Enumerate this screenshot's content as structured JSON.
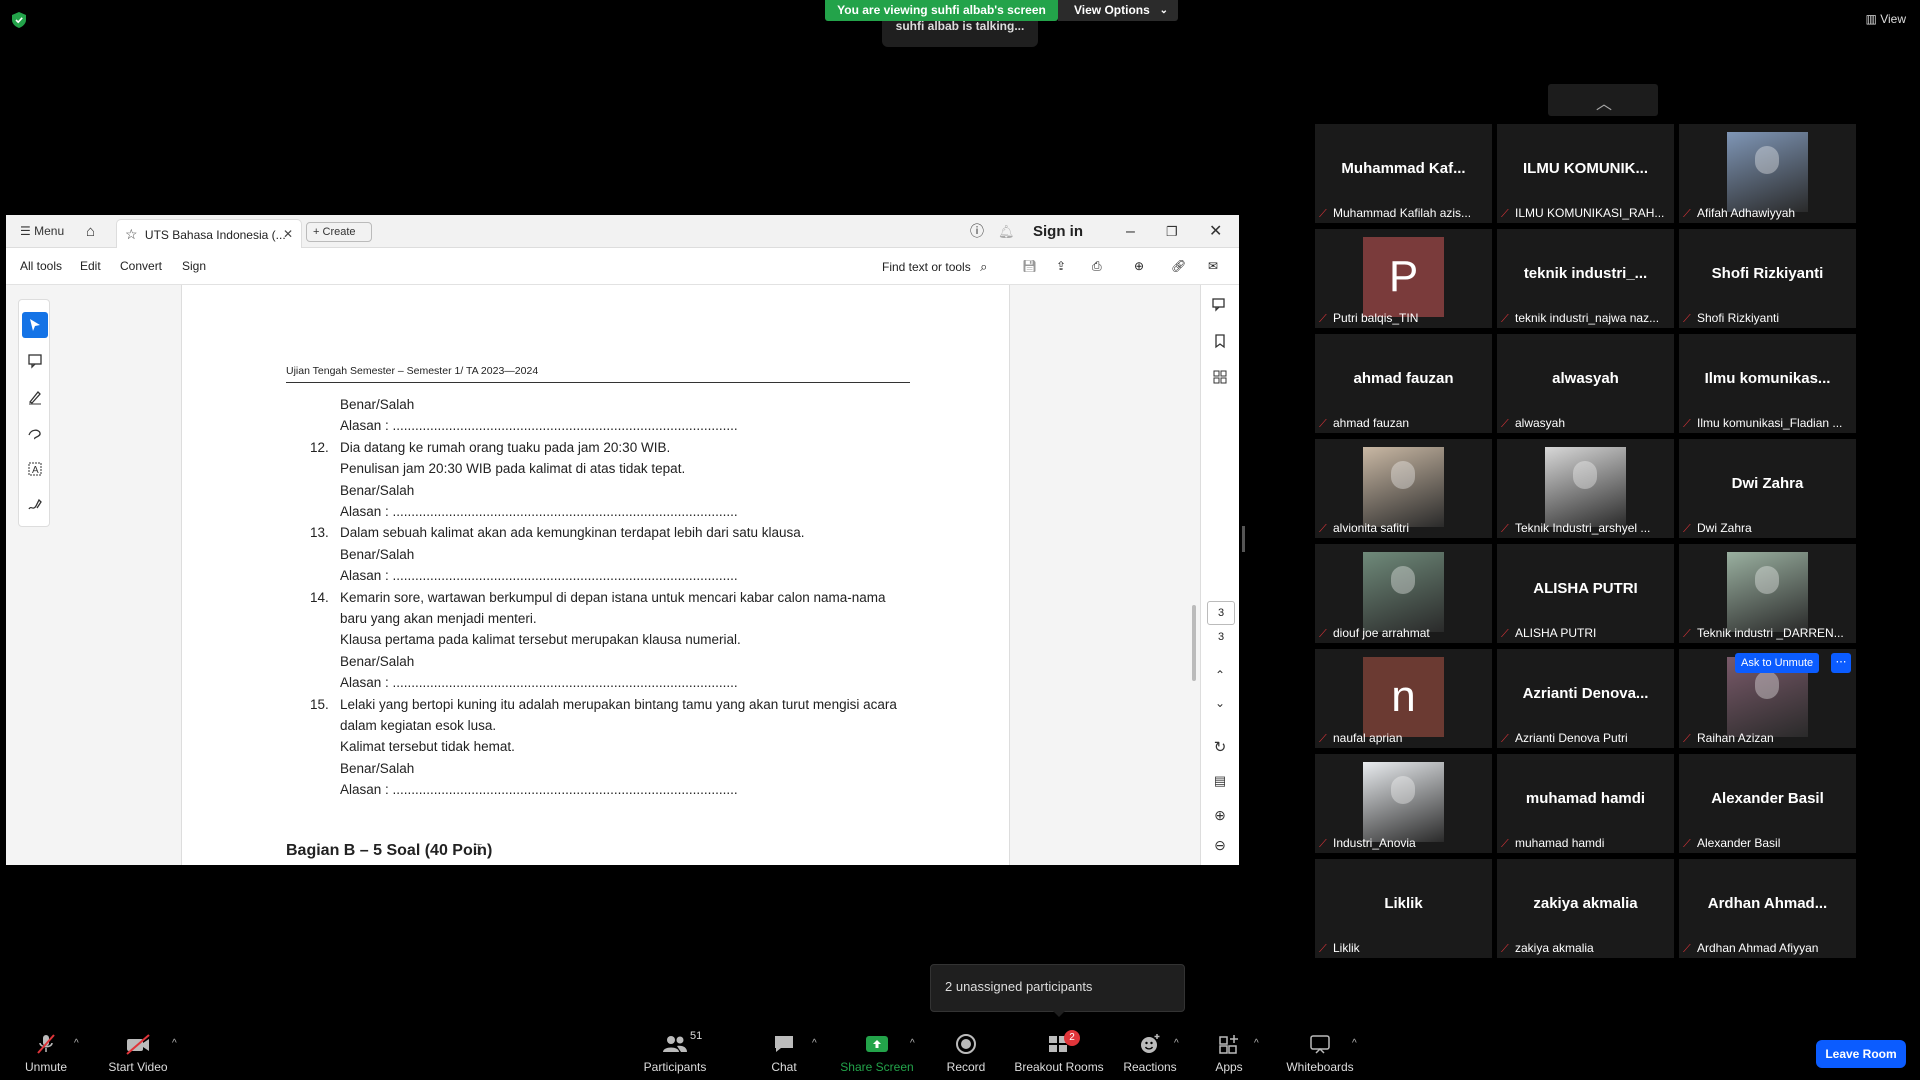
{
  "banner": {
    "viewing": "You are viewing suhfi albab's screen",
    "view_options": "View Options",
    "talking": "suhfi albab is talking..."
  },
  "view_label": "View",
  "window": {
    "menu": "Menu",
    "tab_title": "UTS Bahasa Indonesia (...",
    "create": "Create",
    "sign_in": "Sign in",
    "tools": [
      "All tools",
      "Edit",
      "Convert",
      "Sign"
    ],
    "find": "Find text or tools",
    "page_box": "3",
    "page_total": "3"
  },
  "document": {
    "header": "Ujian Tengah Semester  – Semester 1/ TA 2023—2024",
    "lines": [
      {
        "num": "",
        "text": "Benar/Salah"
      },
      {
        "num": "",
        "text": "Alasan : ............................................................................................"
      },
      {
        "num": "12.",
        "text": "Dia datang ke rumah orang tuaku pada jam 20:30 WIB."
      },
      {
        "num": "",
        "text": "Penulisan jam 20:30 WIB pada kalimat di atas tidak tepat."
      },
      {
        "num": "",
        "text": "Benar/Salah"
      },
      {
        "num": "",
        "text": "Alasan : ............................................................................................"
      },
      {
        "num": "13.",
        "text": "Dalam sebuah kalimat akan ada kemungkinan terdapat lebih dari satu klausa."
      },
      {
        "num": "",
        "text": "Benar/Salah"
      },
      {
        "num": "",
        "text": "Alasan : ............................................................................................"
      },
      {
        "num": "14.",
        "text": "Kemarin sore, wartawan berkumpul di depan istana untuk mencari kabar calon nama-nama"
      },
      {
        "num": "",
        "text": "baru yang akan menjadi menteri."
      },
      {
        "num": "",
        "text": "Klausa pertama pada kalimat tersebut merupakan klausa numerial."
      },
      {
        "num": "",
        "text": "Benar/Salah"
      },
      {
        "num": "",
        "text": "Alasan : ............................................................................................"
      },
      {
        "num": "15.",
        "text": "Lelaki yang bertopi kuning itu adalah merupakan bintang tamu yang akan turut mengisi acara"
      },
      {
        "num": "",
        "text": "dalam kegiatan esok lusa."
      },
      {
        "num": "",
        "text": "Kalimat tersebut tidak hemat."
      },
      {
        "num": "",
        "text": "Benar/Salah"
      },
      {
        "num": "",
        "text": "Alasan : ............................................................................................"
      }
    ],
    "section": "Bagian B – 5 Soal (40 Poin)"
  },
  "participants": [
    {
      "display": "Muhammad  Kaf...",
      "label": "Muhammad Kafilah azis...",
      "type": "name"
    },
    {
      "display": "ILMU  KOMUNIK...",
      "label": "ILMU KOMUNIKASI_RAH...",
      "type": "name"
    },
    {
      "display": "",
      "label": "Afifah Adhawiyyah",
      "type": "photo",
      "color": "#7f96b6"
    },
    {
      "display": "P",
      "label": "Putri balqis_TIN",
      "type": "letter",
      "color": "#7a3b3b"
    },
    {
      "display": "teknik  industri_...",
      "label": "teknik industri_najwa naz...",
      "type": "name"
    },
    {
      "display": "Shofi Rizkiyanti",
      "label": "Shofi Rizkiyanti",
      "type": "name"
    },
    {
      "display": "ahmad fauzan",
      "label": "ahmad fauzan",
      "type": "name"
    },
    {
      "display": "alwasyah",
      "label": "alwasyah",
      "type": "name"
    },
    {
      "display": "Ilmu  komunikas...",
      "label": "Ilmu komunikasi_Fladian ...",
      "type": "name"
    },
    {
      "display": "",
      "label": "alvionita safitri",
      "type": "photo",
      "color": "#c9b8a4"
    },
    {
      "display": "",
      "label": "Teknik Industri_arshyel ...",
      "type": "photo",
      "color": "#d8d8d8"
    },
    {
      "display": "Dwi Zahra",
      "label": "Dwi Zahra",
      "type": "name"
    },
    {
      "display": "",
      "label": "diouf joe arrahmat",
      "type": "photo",
      "color": "#6f8a7a"
    },
    {
      "display": "ALISHA PUTRI",
      "label": "ALISHA PUTRI",
      "type": "name"
    },
    {
      "display": "",
      "label": "Teknik industri _DARREN...",
      "type": "photo",
      "color": "#9ab0a0"
    },
    {
      "display": "n",
      "label": "naufal aprian",
      "type": "letter",
      "color": "#6b3a32"
    },
    {
      "display": "Azrianti  Denova...",
      "label": "Azrianti Denova Putri",
      "type": "name"
    },
    {
      "display": "",
      "label": "Raihan Azizan",
      "type": "photo",
      "color": "#7a5a6a",
      "ask": "Ask to Unmute"
    },
    {
      "display": "",
      "label": "Industri_Anovia",
      "type": "photo",
      "color": "#e9ecef"
    },
    {
      "display": "muhamad hamdi",
      "label": "muhamad hamdi",
      "type": "name"
    },
    {
      "display": "Alexander Basil",
      "label": "Alexander Basil",
      "type": "name"
    },
    {
      "display": "Liklik",
      "label": "Liklik",
      "type": "name"
    },
    {
      "display": "zakiya akmalia",
      "label": "zakiya akmalia",
      "type": "name"
    },
    {
      "display": "Ardhan  Ahmad...",
      "label": "Ardhan Ahmad Afiyyan",
      "type": "name"
    }
  ],
  "toolbar": {
    "unmute": "Unmute",
    "start_video": "Start Video",
    "participants": "Participants",
    "participants_count": "51",
    "chat": "Chat",
    "share_screen": "Share Screen",
    "record": "Record",
    "breakout": "Breakout Rooms",
    "breakout_badge": "2",
    "reactions": "Reactions",
    "apps": "Apps",
    "whiteboards": "Whiteboards",
    "leave": "Leave Room"
  },
  "tooltip": "2 unassigned participants",
  "colors": {
    "zoom_green": "#23a34a",
    "zoom_blue": "#0b5cff",
    "mute_red": "#e0353a",
    "tile_bg": "#1a1a1a"
  }
}
